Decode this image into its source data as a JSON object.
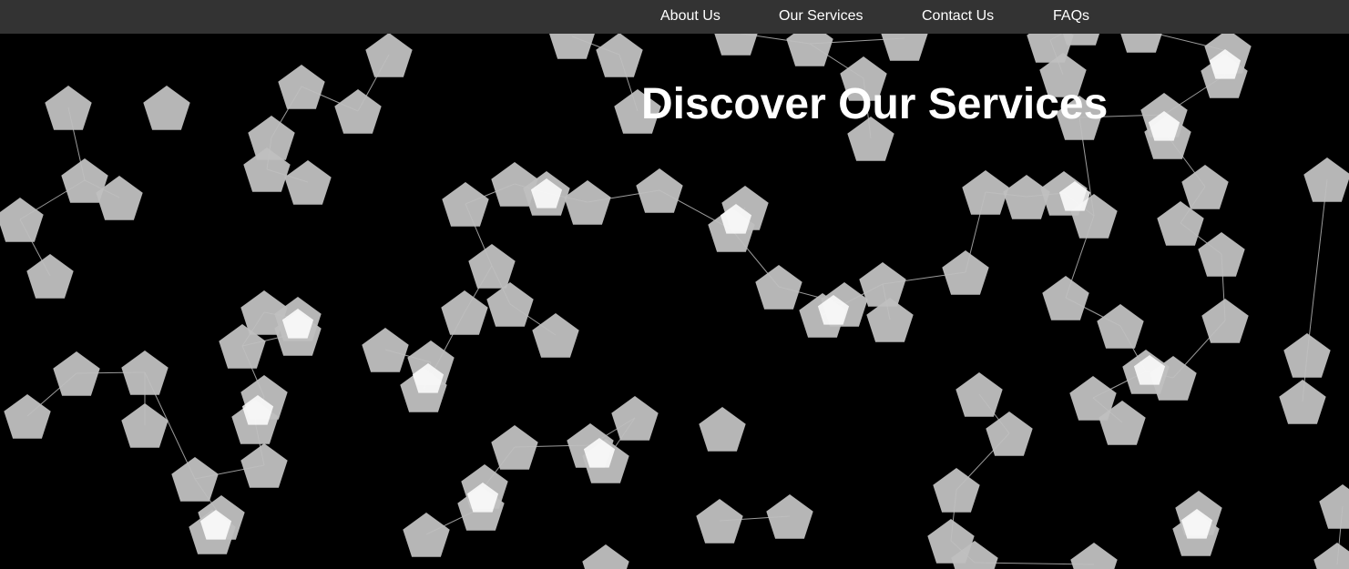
{
  "nav": {
    "items": [
      {
        "label": "About Us"
      },
      {
        "label": "Our Services"
      },
      {
        "label": "Contact Us"
      },
      {
        "label": "FAQs"
      }
    ]
  },
  "hero": {
    "title": "Discover Our Services"
  },
  "colors": {
    "background": "#000000",
    "navbar": "#333333",
    "text": "#ffffff",
    "particle": "#c0c0c0",
    "particle_overlap": "#ffffff",
    "link_line": "#dddddd"
  }
}
